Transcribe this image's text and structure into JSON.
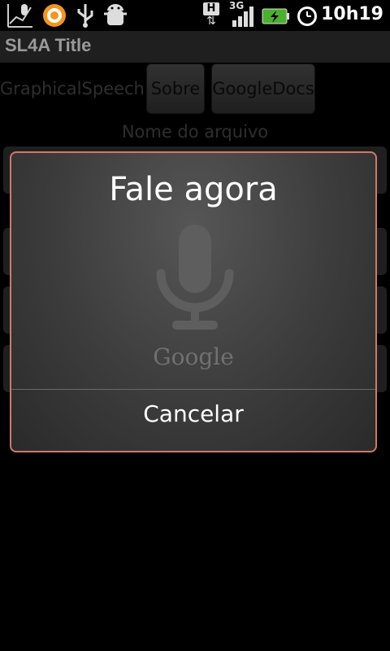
{
  "status_bar": {
    "clock": "10h19",
    "network_type": "3G",
    "data_indicator": "H",
    "icons": [
      "voice-search-icon",
      "app-circle-icon",
      "usb-icon",
      "android-debug-icon",
      "data-arrows-icon",
      "signal-icon",
      "battery-charging-icon",
      "alarm-icon"
    ]
  },
  "title_bar": {
    "title": "SL4A Title"
  },
  "app": {
    "label": "GraphicalSpeech",
    "buttons": {
      "sobre": "Sobre",
      "googledocs": "GoogleDocs"
    },
    "filename_label": "Nome do arquivo"
  },
  "dialog": {
    "title": "Fale agora",
    "brand": "Google",
    "cancel_label": "Cancelar",
    "border_color": "#d07868"
  }
}
